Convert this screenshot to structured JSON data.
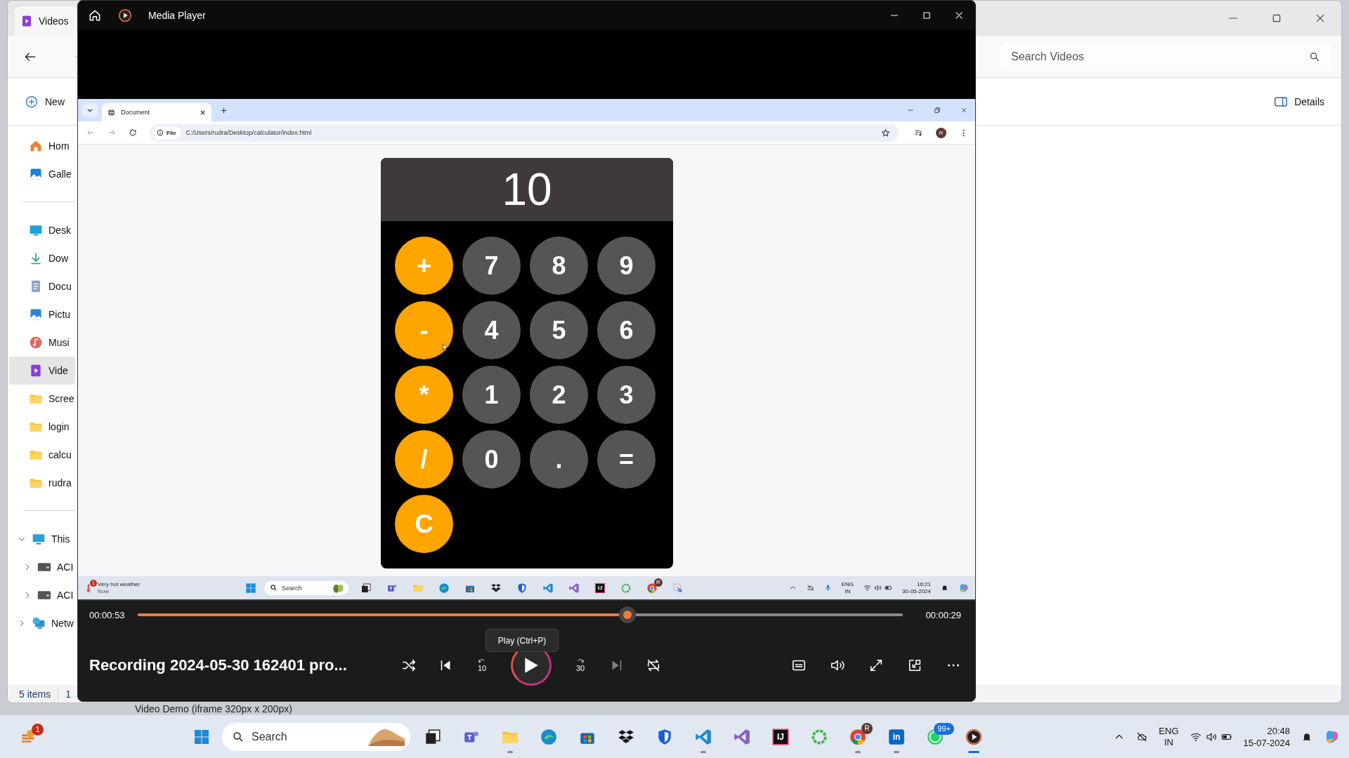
{
  "explorer": {
    "tab": "Videos",
    "search": {
      "placeholder": "Search Videos"
    },
    "new_button": "New",
    "details_button": "Details",
    "nav": [
      [
        {
          "label": "Hom",
          "kind": "home",
          "selected": false
        },
        {
          "label": "Galle",
          "kind": "gallery",
          "selected": false
        }
      ],
      [
        {
          "label": "Desk",
          "kind": "desktop",
          "selected": false
        },
        {
          "label": "Dow",
          "kind": "download",
          "selected": false
        },
        {
          "label": "Docu",
          "kind": "document",
          "selected": false
        },
        {
          "label": "Pictu",
          "kind": "picture",
          "selected": false
        },
        {
          "label": "Musi",
          "kind": "music",
          "selected": false
        },
        {
          "label": "Vide",
          "kind": "video",
          "selected": true
        },
        {
          "label": "Scree",
          "kind": "folder",
          "selected": false
        },
        {
          "label": "login",
          "kind": "folder",
          "selected": false
        },
        {
          "label": "calcu",
          "kind": "folder",
          "selected": false
        },
        {
          "label": "rudra",
          "kind": "folder",
          "selected": false
        }
      ],
      [
        {
          "label": "This",
          "kind": "pc",
          "selected": false,
          "expanded": true,
          "children": [
            {
              "label": "ACI",
              "kind": "drive",
              "selected": false,
              "expanded": false
            },
            {
              "label": "ACI",
              "kind": "drive",
              "selected": false,
              "expanded": false
            }
          ]
        },
        {
          "label": "Netw",
          "kind": "network",
          "selected": false,
          "expanded": false
        }
      ]
    ],
    "status": [
      "5 items",
      "1"
    ]
  },
  "background_window": {
    "text": "Video Demo (iframe 320px x 200px)"
  },
  "player": {
    "title": "Media Player",
    "browser": {
      "tab": "Document",
      "file_chip": "File",
      "url": "C:/Users/rudra/Desktop/calculator/index.html",
      "avatar": "R",
      "calculator": {
        "display": "10",
        "keys": [
          {
            "label": "+",
            "kind": "operator"
          },
          {
            "label": "7",
            "kind": "key"
          },
          {
            "label": "8",
            "kind": "key"
          },
          {
            "label": "9",
            "kind": "key"
          },
          {
            "label": "-",
            "kind": "operator"
          },
          {
            "label": "4",
            "kind": "key"
          },
          {
            "label": "5",
            "kind": "key"
          },
          {
            "label": "6",
            "kind": "key"
          },
          {
            "label": "*",
            "kind": "operator"
          },
          {
            "label": "1",
            "kind": "key"
          },
          {
            "label": "2",
            "kind": "key"
          },
          {
            "label": "3",
            "kind": "key"
          },
          {
            "label": "/",
            "kind": "operator"
          },
          {
            "label": "0",
            "kind": "key"
          },
          {
            "label": ".",
            "kind": "key"
          },
          {
            "label": "=",
            "kind": "key"
          },
          {
            "label": "C",
            "kind": "operator"
          }
        ]
      },
      "taskbar": {
        "weather": "Very hot weather",
        "weather_time": "Now",
        "weather_badge": "1",
        "search": "Search",
        "apps": [
          {
            "kind": "avocado"
          },
          {
            "kind": "taskview"
          },
          {
            "kind": "teams"
          },
          {
            "kind": "folder"
          },
          {
            "kind": "edge"
          },
          {
            "kind": "store"
          },
          {
            "kind": "dropbox"
          },
          {
            "kind": "shield"
          },
          {
            "kind": "vscode"
          },
          {
            "kind": "vstudio"
          },
          {
            "kind": "intellij",
            "glyph": "IJ"
          },
          {
            "kind": "ring"
          },
          {
            "kind": "chrome",
            "badge": "R"
          },
          {
            "kind": "snip"
          }
        ],
        "lang": "ENG",
        "region": "IN",
        "time": "16:21",
        "date": "30-05-2024"
      }
    },
    "elapsed": "00:00:53",
    "remaining": "00:00:29",
    "level": 0.64,
    "tooltip": "Play (Ctrl+P)",
    "media_title": "Recording 2024-05-30 162401 pro...",
    "transport": [
      {
        "kind": "shuffle",
        "disabled": false
      },
      {
        "kind": "previous",
        "disabled": false
      },
      {
        "kind": "rewind",
        "label": "10",
        "disabled": false
      },
      {
        "kind": "play",
        "disabled": false
      },
      {
        "kind": "forward",
        "label": "30",
        "disabled": false
      },
      {
        "kind": "next",
        "disabled": true
      },
      {
        "kind": "repeat",
        "disabled": false
      }
    ],
    "options": [
      {
        "kind": "captions"
      },
      {
        "kind": "volume"
      },
      {
        "kind": "fullscreen"
      },
      {
        "kind": "miniplayer"
      },
      {
        "kind": "more"
      }
    ]
  },
  "taskbar": {
    "weather_badge": "1",
    "search": "Search",
    "apps": [
      {
        "kind": "taskview",
        "running": false,
        "active": false
      },
      {
        "kind": "teams",
        "running": false,
        "active": false
      },
      {
        "kind": "folder",
        "running": true,
        "active": false
      },
      {
        "kind": "edge",
        "running": false,
        "active": false
      },
      {
        "kind": "store",
        "running": false,
        "active": false
      },
      {
        "kind": "dropbox",
        "running": false,
        "active": false
      },
      {
        "kind": "shield",
        "running": false,
        "active": false
      },
      {
        "kind": "vscode",
        "running": true,
        "active": false
      },
      {
        "kind": "vstudio",
        "running": false,
        "active": false
      },
      {
        "kind": "intellij",
        "glyph": "IJ",
        "running": false,
        "active": false
      },
      {
        "kind": "ring",
        "running": false,
        "active": false
      },
      {
        "kind": "chrome",
        "badge": "R",
        "running": true,
        "active": false
      },
      {
        "kind": "linkedin",
        "glyph": "in",
        "running": true,
        "active": false
      },
      {
        "kind": "whatsapp",
        "badge": "99+",
        "running": false,
        "active": false
      },
      {
        "kind": "mediaplayer",
        "running": true,
        "active": true
      }
    ],
    "lang": "ENG",
    "region": "IN",
    "time": "20:48",
    "date": "15-07-2024"
  }
}
